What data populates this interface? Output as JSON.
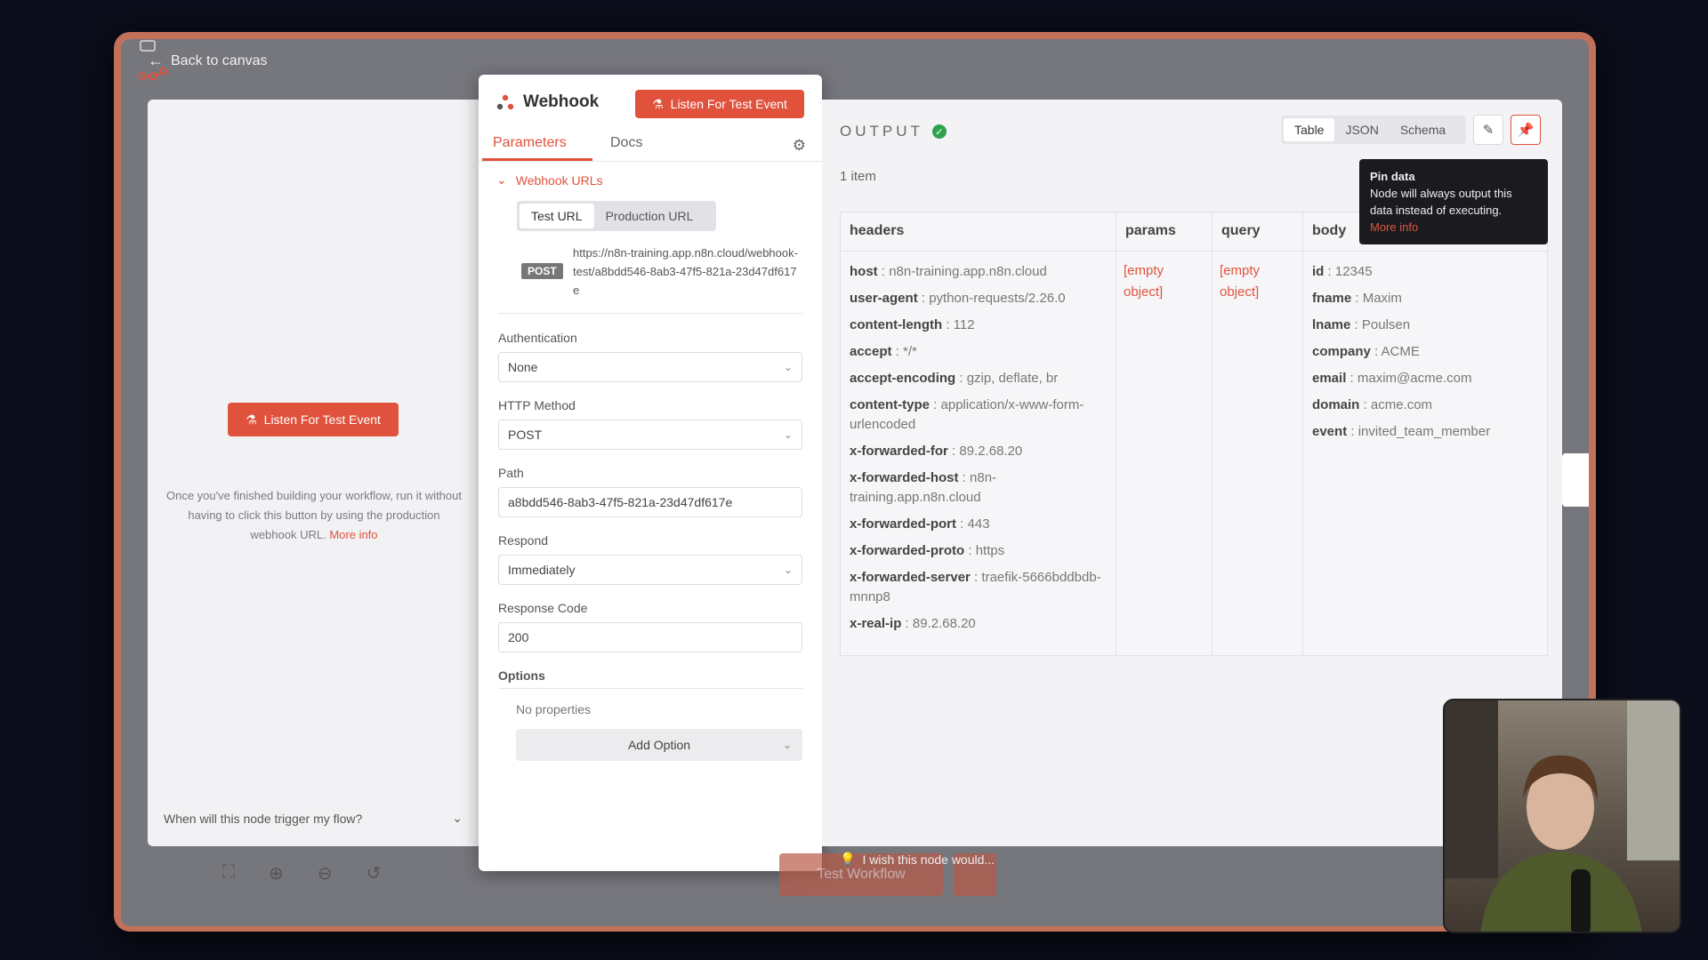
{
  "nav": {
    "back_label": "Back to canvas"
  },
  "left_panel": {
    "listen_button": "Listen For Test Event",
    "help_text": "Once you've finished building your workflow, run it without having to click this button by using the production webhook URL.",
    "help_link": "More info",
    "trigger_question": "When will this node trigger my flow?"
  },
  "node": {
    "title": "Webhook",
    "listen_button": "Listen For Test Event",
    "tabs": [
      {
        "label": "Parameters"
      },
      {
        "label": "Docs"
      }
    ],
    "webhook_urls_label": "Webhook URLs",
    "url_tabs": [
      {
        "label": "Test URL"
      },
      {
        "label": "Production URL"
      }
    ],
    "method_badge": "POST",
    "url": "https://n8n-training.app.n8n.cloud/webhook-test/a8bdd546-8ab3-47f5-821a-23d47df617e",
    "fields": {
      "authentication": {
        "label": "Authentication",
        "value": "None"
      },
      "http_method": {
        "label": "HTTP Method",
        "value": "POST"
      },
      "path": {
        "label": "Path",
        "value": "a8bdd546-8ab3-47f5-821a-23d47df617e"
      },
      "respond": {
        "label": "Respond",
        "value": "Immediately"
      },
      "response_code": {
        "label": "Response Code",
        "value": "200"
      }
    },
    "options_label": "Options",
    "no_properties": "No properties",
    "add_option": "Add Option"
  },
  "output": {
    "title": "OUTPUT",
    "item_count": "1 item",
    "view_modes": [
      {
        "label": "Table"
      },
      {
        "label": "JSON"
      },
      {
        "label": "Schema"
      }
    ],
    "tooltip": {
      "title": "Pin data",
      "body": "Node will always output this data instead of executing.",
      "link": "More info"
    },
    "columns": [
      {
        "label": "headers"
      },
      {
        "label": "params"
      },
      {
        "label": "query"
      },
      {
        "label": "body"
      }
    ],
    "headers": [
      {
        "k": "host",
        "v": "n8n-training.app.n8n.cloud"
      },
      {
        "k": "user-agent",
        "v": "python-requests/2.26.0"
      },
      {
        "k": "content-length",
        "v": "112"
      },
      {
        "k": "accept",
        "v": "*/*"
      },
      {
        "k": "accept-encoding",
        "v": "gzip, deflate, br"
      },
      {
        "k": "content-type",
        "v": "application/x-www-form-urlencoded"
      },
      {
        "k": "x-forwarded-for",
        "v": "89.2.68.20"
      },
      {
        "k": "x-forwarded-host",
        "v": "n8n-training.app.n8n.cloud"
      },
      {
        "k": "x-forwarded-port",
        "v": "443"
      },
      {
        "k": "x-forwarded-proto",
        "v": "https"
      },
      {
        "k": "x-forwarded-server",
        "v": "traefik-5666bddbdb-mnnp8"
      },
      {
        "k": "x-real-ip",
        "v": "89.2.68.20"
      }
    ],
    "params_value": "[empty object]",
    "query_value": "[empty object]",
    "body": [
      {
        "k": "id",
        "v": "12345"
      },
      {
        "k": "fname",
        "v": "Maxim"
      },
      {
        "k": "lname",
        "v": "Poulsen"
      },
      {
        "k": "company",
        "v": "ACME"
      },
      {
        "k": "email",
        "v": "maxim@acme.com"
      },
      {
        "k": "domain",
        "v": "acme.com"
      },
      {
        "k": "event",
        "v": "invited_team_member"
      }
    ]
  },
  "bottom": {
    "test_workflow": "Test Workflow",
    "wish": "I wish this node would..."
  },
  "colors": {
    "accent": "#e0523c",
    "success": "#2fa24e",
    "frame": "#c07158"
  }
}
